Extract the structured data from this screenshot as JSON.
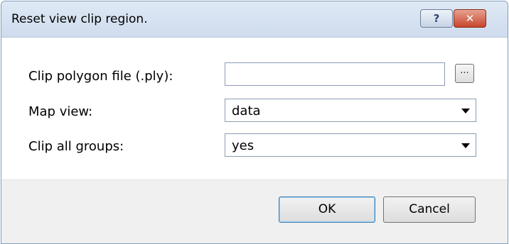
{
  "dialog": {
    "title": "Reset view clip region.",
    "help_label": "?",
    "close_label": "✕"
  },
  "form": {
    "clip_file_label": "Clip polygon file (.ply):",
    "clip_file_value": "",
    "browse_label": "...",
    "map_view_label": "Map view:",
    "map_view_value": "data",
    "clip_groups_label": "Clip all groups:",
    "clip_groups_value": "yes"
  },
  "buttons": {
    "ok": "OK",
    "cancel": "Cancel"
  }
}
